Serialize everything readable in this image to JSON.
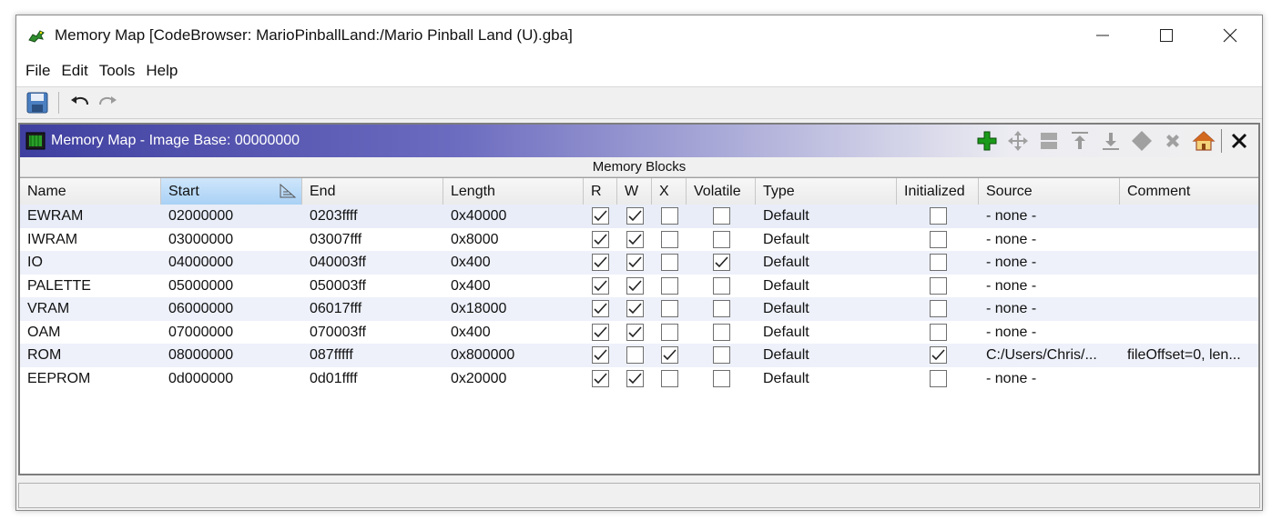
{
  "window": {
    "title": "Memory Map [CodeBrowser: MarioPinballLand:/Mario Pinball Land (U).gba]",
    "controls": [
      "minimize",
      "maximize",
      "close"
    ]
  },
  "menu": [
    "File",
    "Edit",
    "Tools",
    "Help"
  ],
  "toolbar": {
    "icons": [
      "save-icon",
      "undo-icon",
      "redo-icon"
    ]
  },
  "panel": {
    "title": "Memory Map - Image Base: 00000000",
    "actions": [
      "add-icon",
      "move-icon",
      "split-icon",
      "expand-up-icon",
      "expand-down-icon",
      "merge-icon",
      "delete-icon",
      "home-icon",
      "close-icon"
    ],
    "section_label": "Memory Blocks"
  },
  "table": {
    "columns": [
      "Name",
      "Start",
      "End",
      "Length",
      "R",
      "W",
      "X",
      "Volatile",
      "Type",
      "Initialized",
      "Source",
      "Comment"
    ],
    "sorted_column": "Start",
    "rows": [
      {
        "name": "EWRAM",
        "start": "02000000",
        "end": "0203ffff",
        "length": "0x40000",
        "r": true,
        "w": true,
        "x": false,
        "volatile": false,
        "type": "Default",
        "initialized": false,
        "source": "- none -",
        "comment": ""
      },
      {
        "name": "IWRAM",
        "start": "03000000",
        "end": "03007fff",
        "length": "0x8000",
        "r": true,
        "w": true,
        "x": false,
        "volatile": false,
        "type": "Default",
        "initialized": false,
        "source": "- none -",
        "comment": ""
      },
      {
        "name": "IO",
        "start": "04000000",
        "end": "040003ff",
        "length": "0x400",
        "r": true,
        "w": true,
        "x": false,
        "volatile": true,
        "type": "Default",
        "initialized": false,
        "source": "- none -",
        "comment": ""
      },
      {
        "name": "PALETTE",
        "start": "05000000",
        "end": "050003ff",
        "length": "0x400",
        "r": true,
        "w": true,
        "x": false,
        "volatile": false,
        "type": "Default",
        "initialized": false,
        "source": "- none -",
        "comment": ""
      },
      {
        "name": "VRAM",
        "start": "06000000",
        "end": "06017fff",
        "length": "0x18000",
        "r": true,
        "w": true,
        "x": false,
        "volatile": false,
        "type": "Default",
        "initialized": false,
        "source": "- none -",
        "comment": ""
      },
      {
        "name": "OAM",
        "start": "07000000",
        "end": "070003ff",
        "length": "0x400",
        "r": true,
        "w": true,
        "x": false,
        "volatile": false,
        "type": "Default",
        "initialized": false,
        "source": "- none -",
        "comment": ""
      },
      {
        "name": "ROM",
        "start": "08000000",
        "end": "087fffff",
        "length": "0x800000",
        "r": true,
        "w": false,
        "x": true,
        "volatile": false,
        "type": "Default",
        "initialized": true,
        "source": "C:/Users/Chris/...",
        "comment": "fileOffset=0, len..."
      },
      {
        "name": "EEPROM",
        "start": "0d000000",
        "end": "0d01ffff",
        "length": "0x20000",
        "r": true,
        "w": true,
        "x": false,
        "volatile": false,
        "type": "Default",
        "initialized": false,
        "source": "- none -",
        "comment": ""
      }
    ]
  },
  "colors": {
    "panel_header_start": "#3f3fa0",
    "sorted_header": "#a9d1f5",
    "selected_row": "#e8edf8"
  }
}
